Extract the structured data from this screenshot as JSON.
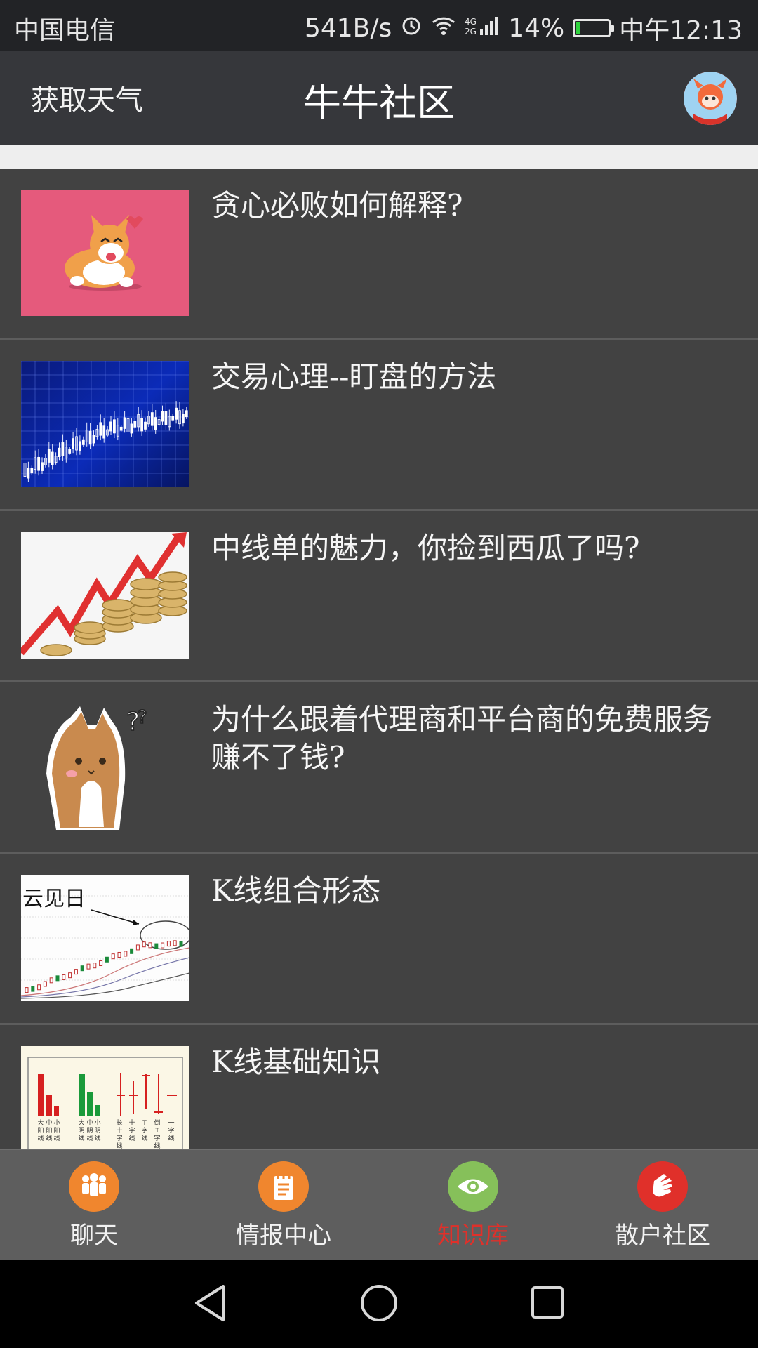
{
  "status_bar": {
    "carrier": "中国电信",
    "net_speed": "541B/s",
    "network": "4G 2G",
    "battery": "14%",
    "battery_level": 0.14,
    "time": "中午12:13"
  },
  "header": {
    "weather_button": "获取天气",
    "title": "牛牛社区"
  },
  "articles": [
    {
      "title": "贪心必败如何解释?",
      "thumb_icon": "corgi-sticker-icon"
    },
    {
      "title": "交易心理--盯盘的方法",
      "thumb_icon": "candlestick-chart-icon"
    },
    {
      "title": "中线单的魅力，你捡到西瓜了吗?",
      "thumb_icon": "coins-rising-arrow-icon"
    },
    {
      "title": "为什么跟着代理商和平台商的免费服务赚不了钱?",
      "thumb_icon": "confused-cat-sticker-icon"
    },
    {
      "title": "K线组合形态",
      "thumb_icon": "kline-pattern-chart-icon",
      "thumb_text": "云见日"
    },
    {
      "title": "K线基础知识",
      "thumb_icon": "kline-basics-chart-icon",
      "thumb_labels": [
        "大阳线",
        "中阳线",
        "小阳线",
        "大阴线",
        "中阴线",
        "小阴线",
        "长十字线",
        "十字线",
        "T字线",
        "倒T字线",
        "一字线"
      ]
    }
  ],
  "tabs": [
    {
      "label": "聊天",
      "icon": "people-icon",
      "color": "#f0862e"
    },
    {
      "label": "情报中心",
      "icon": "notepad-icon",
      "color": "#f0862e"
    },
    {
      "label": "知识库",
      "icon": "eye-icon",
      "color": "#86c05a",
      "active": true
    },
    {
      "label": "散户社区",
      "icon": "hand-icon",
      "color": "#e0302a"
    }
  ],
  "colors": {
    "active_tab": "#e0302a",
    "list_bg": "#424242",
    "header_bg": "#36373b"
  }
}
